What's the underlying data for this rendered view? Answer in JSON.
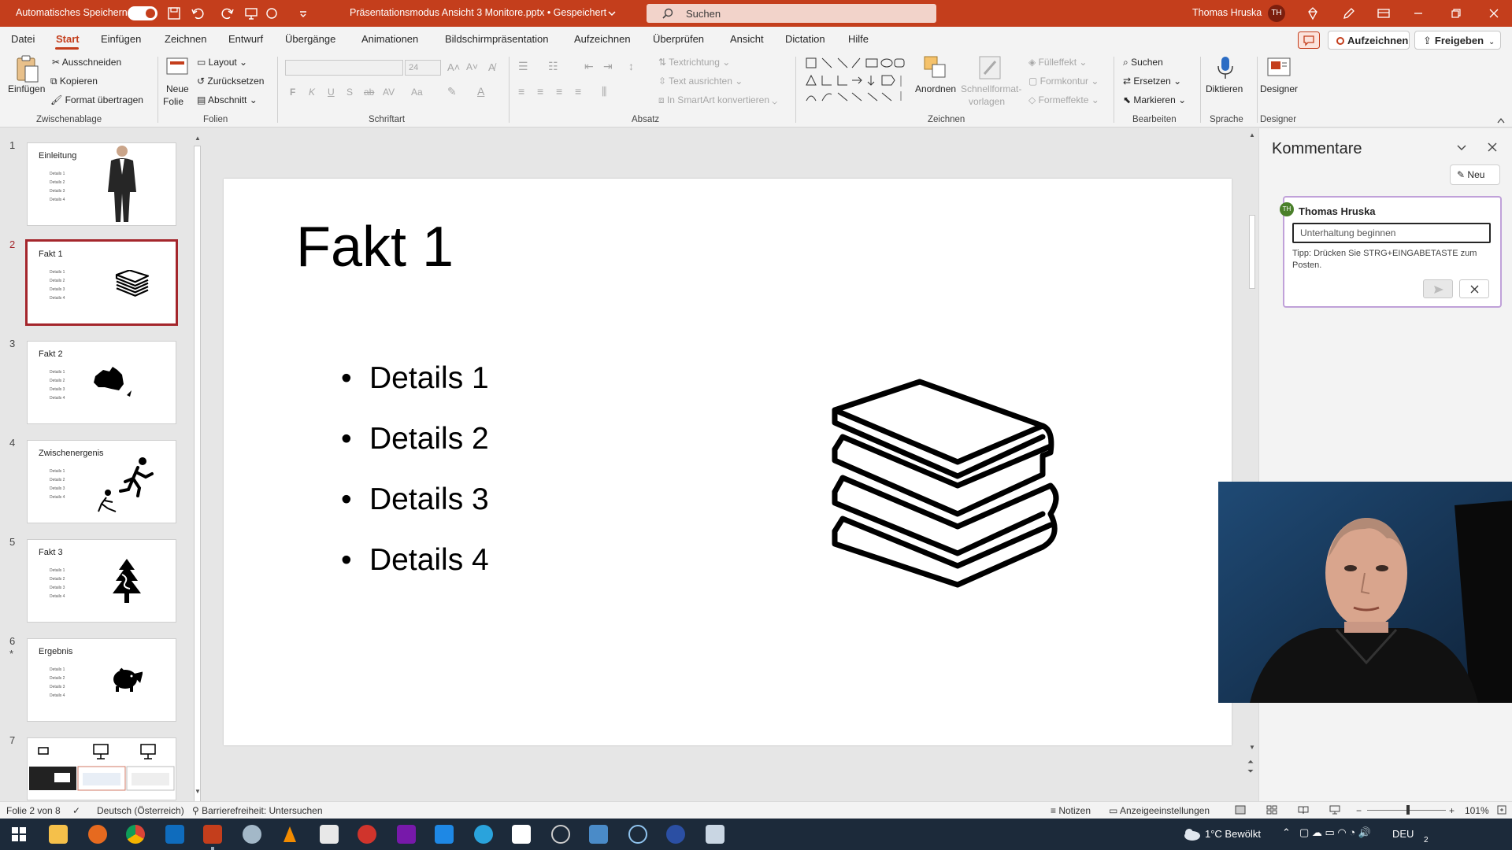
{
  "titlebar": {
    "autosave_label": "Automatisches Speichern",
    "autosave_state": "Ein",
    "document_title": "Präsentationsmodus Ansicht 3 Monitore.pptx • Gespeichert",
    "search_placeholder": "Suchen",
    "user_name": "Thomas Hruska",
    "user_initials": "TH",
    "accent_color": "#c43e1c"
  },
  "menu": {
    "items": [
      "Datei",
      "Start",
      "Einfügen",
      "Zeichnen",
      "Entwurf",
      "Übergänge",
      "Animationen",
      "Bildschirmpräsentation",
      "Aufzeichnen",
      "Überprüfen",
      "Ansicht",
      "Dictation",
      "Hilfe"
    ],
    "active": "Start",
    "record_button": "Aufzeichnen",
    "share_button": "Freigeben"
  },
  "ribbon": {
    "clipboard": {
      "paste": "Einfügen",
      "cut": "Ausschneiden",
      "copy": "Kopieren",
      "format_painter": "Format übertragen",
      "label": "Zwischenablage"
    },
    "slides": {
      "new_slide_1": "Neue",
      "new_slide_2": "Folie",
      "layout": "Layout",
      "reset": "Zurücksetzen",
      "section": "Abschnitt",
      "label": "Folien"
    },
    "font": {
      "font_name": "",
      "font_size": "24",
      "bold": "F",
      "italic": "K",
      "underline": "U",
      "shadow": "S",
      "strike": "ab",
      "spacing": "AV",
      "case": "Aa",
      "label": "Schriftart"
    },
    "paragraph": {
      "text_direction": "Textrichtung",
      "align_text": "Text ausrichten",
      "smartart": "In SmartArt konvertieren",
      "label": "Absatz"
    },
    "drawing": {
      "arrange": "Anordnen",
      "quick_styles_1": "Schnellformat-",
      "quick_styles_2": "vorlagen",
      "fill": "Fülleffekt",
      "outline": "Formkontur",
      "effects": "Formeffekte",
      "label": "Zeichnen"
    },
    "editing": {
      "find": "Suchen",
      "replace": "Ersetzen",
      "select": "Markieren",
      "label": "Bearbeiten"
    },
    "voice": {
      "dictate": "Diktieren",
      "label": "Sprache"
    },
    "designer": {
      "button": "Designer",
      "label": "Designer"
    }
  },
  "thumbnails": [
    {
      "num": "1",
      "title": "Einleitung",
      "bullets": [
        "Details 1",
        "Details 2",
        "Details 3",
        "Details 4"
      ],
      "image": "person-photo"
    },
    {
      "num": "2",
      "title": "Fakt 1",
      "bullets": [
        "Details 1",
        "Details 2",
        "Details 3",
        "Details 4"
      ],
      "image": "books-icon"
    },
    {
      "num": "3",
      "title": "Fakt 2",
      "bullets": [
        "Details 1",
        "Details 2",
        "Details 3",
        "Details 4"
      ],
      "image": "australia-map-icon"
    },
    {
      "num": "4",
      "title": "Zwischenergenis",
      "bullets": [
        "Details 1",
        "Details 2",
        "Details 3",
        "Details 4"
      ],
      "image": "runner-icon"
    },
    {
      "num": "5",
      "title": "Fakt 3",
      "bullets": [
        "Details 1",
        "Details 2",
        "Details 3",
        "Details 4"
      ],
      "image": "tree-icon"
    },
    {
      "num": "6",
      "title": "Ergebnis",
      "bullets": [
        "Details 1",
        "Details 2",
        "Details 3",
        "Details 4"
      ],
      "image": "piggy-bank-icon",
      "marker": "*"
    },
    {
      "num": "7",
      "title": "",
      "bullets": [],
      "image": "monitors-icon"
    }
  ],
  "slide": {
    "title": "Fakt 1",
    "bullets": [
      "Details 1",
      "Details 2",
      "Details 3",
      "Details 4"
    ],
    "image": "books-icon"
  },
  "comments": {
    "title": "Kommentare",
    "new_button": "Neu",
    "author_initials": "TH",
    "author": "Thomas Hruska",
    "input_value": "Unterhaltung beginnen",
    "tip": "Tipp: Drücken Sie STRG+EINGABETASTE zum Posten."
  },
  "statusbar": {
    "slide_info": "Folie 2 von 8",
    "language": "Deutsch (Österreich)",
    "accessibility": "Barrierefreiheit: Untersuchen",
    "notes": "Notizen",
    "display_settings": "Anzeigeeinstellungen",
    "zoom": "101%",
    "zoom_level": 0.52
  },
  "taskbar": {
    "weather": "1°C  Bewölkt",
    "language": "DEU",
    "notification_count": "2"
  }
}
